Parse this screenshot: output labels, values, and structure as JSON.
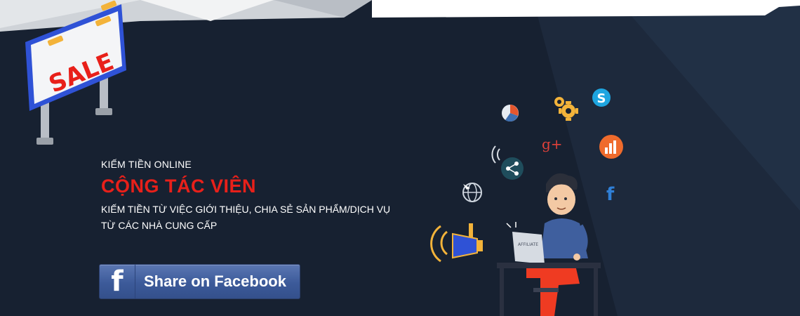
{
  "billboard": {
    "text": "SALE"
  },
  "hero": {
    "kicker": "KIẾM TIỀN ONLINE",
    "title": "CỘNG TÁC VIÊN",
    "desc_line1": "KIẾM TIỀN TỪ VIỆC GIỚI THIỆU, CHIA SẺ SẢN PHẨM/DỊCH VỤ",
    "desc_line2": "TỪ CÁC NHÀ CUNG CẤP"
  },
  "share_button": {
    "icon": "f",
    "label": "Share on Facebook"
  },
  "illustration": {
    "laptop_label": "AFFILIATE",
    "gplus_text": "g+",
    "facebook_text": "f",
    "skype_text": "S"
  },
  "colors": {
    "background": "#172131",
    "headline_red": "#e8201a",
    "facebook_blue": "#3c5a99",
    "shirt_blue": "#3f5f9e",
    "pants_red": "#ef3b22"
  }
}
